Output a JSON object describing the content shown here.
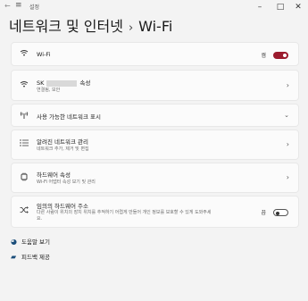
{
  "window": {
    "back_icon": "back-arrow-icon",
    "menu_icon": "hamburger-menu-icon",
    "title": "설정",
    "minimize": "–",
    "maximize": "□",
    "close": "✕"
  },
  "header": {
    "parent": "네트워크 및 인터넷",
    "separator": "›",
    "current": "Wi-Fi"
  },
  "wifi": {
    "label": "Wi-Fi",
    "state": "켬",
    "on": true
  },
  "network": {
    "name_prefix": "SK",
    "name_suffix": "속성",
    "sub": "연결됨, 보안"
  },
  "available": {
    "label": "사용 가능한 네트워크 표시"
  },
  "known": {
    "label": "알려진 네트워크 관리",
    "sub": "네트워크 추가, 제거 및 편집"
  },
  "hardware": {
    "label": "하드웨어 속성",
    "sub": "Wi-Fi 어댑터 속성 보기 및 관리"
  },
  "random_mac": {
    "label": "임의의 하드웨어 주소",
    "sub_line1": "다른 사람이 위치의 장치 위치를 추적하기 어렵게 만들어 개인 정보를 보호할 수 있게 도와주세",
    "sub_line2": "요.",
    "state": "끔",
    "on": false
  },
  "links": {
    "help": "도움말 보기",
    "feedback": "피드백 제공"
  },
  "colors": {
    "accent": "#9b1b2e",
    "background": "#f3f3f3",
    "card": "#fbfbfb"
  }
}
